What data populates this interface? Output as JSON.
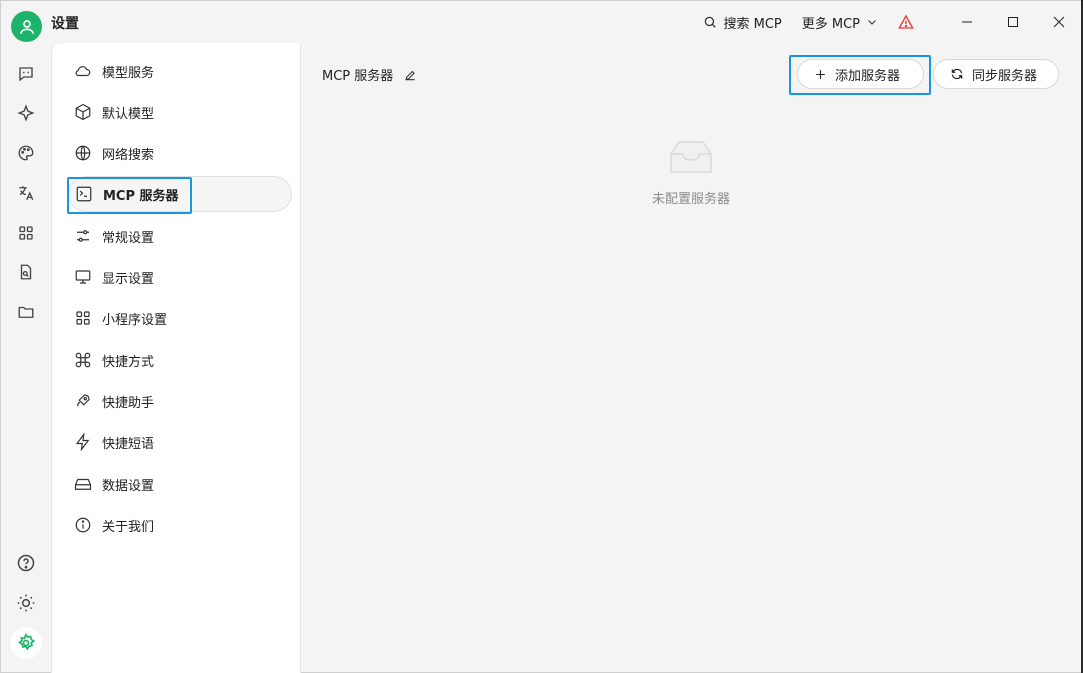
{
  "app": {
    "title": "设置"
  },
  "titlebar": {
    "search_mcp": "搜索 MCP",
    "more_mcp": "更多 MCP",
    "warning_color": "#e53935"
  },
  "rail": {
    "icons": [
      "chat-icon",
      "sparkle-icon",
      "palette-icon",
      "translate-icon",
      "apps-grid-icon",
      "file-search-icon",
      "folder-icon"
    ],
    "bottom": [
      "help-icon",
      "theme-toggle-icon",
      "settings-icon"
    ]
  },
  "nav": {
    "items": [
      {
        "label": "模型服务",
        "icon": "cloud-icon"
      },
      {
        "label": "默认模型",
        "icon": "cube-icon"
      },
      {
        "label": "网络搜索",
        "icon": "globe-icon"
      },
      {
        "label": "MCP 服务器",
        "icon": "terminal-icon",
        "active": true
      },
      {
        "label": "常规设置",
        "icon": "sliders-icon"
      },
      {
        "label": "显示设置",
        "icon": "monitor-icon"
      },
      {
        "label": "小程序设置",
        "icon": "grid-icon"
      },
      {
        "label": "快捷方式",
        "icon": "command-icon"
      },
      {
        "label": "快捷助手",
        "icon": "rocket-icon"
      },
      {
        "label": "快捷短语",
        "icon": "zap-icon"
      },
      {
        "label": "数据设置",
        "icon": "hard-drive-icon"
      },
      {
        "label": "关于我们",
        "icon": "info-icon"
      }
    ]
  },
  "main": {
    "title": "MCP 服务器",
    "add_button": "添加服务器",
    "sync_button": "同步服务器",
    "empty_text": "未配置服务器"
  },
  "colors": {
    "accent": "#1db36b",
    "highlight": "#1a94e6"
  }
}
